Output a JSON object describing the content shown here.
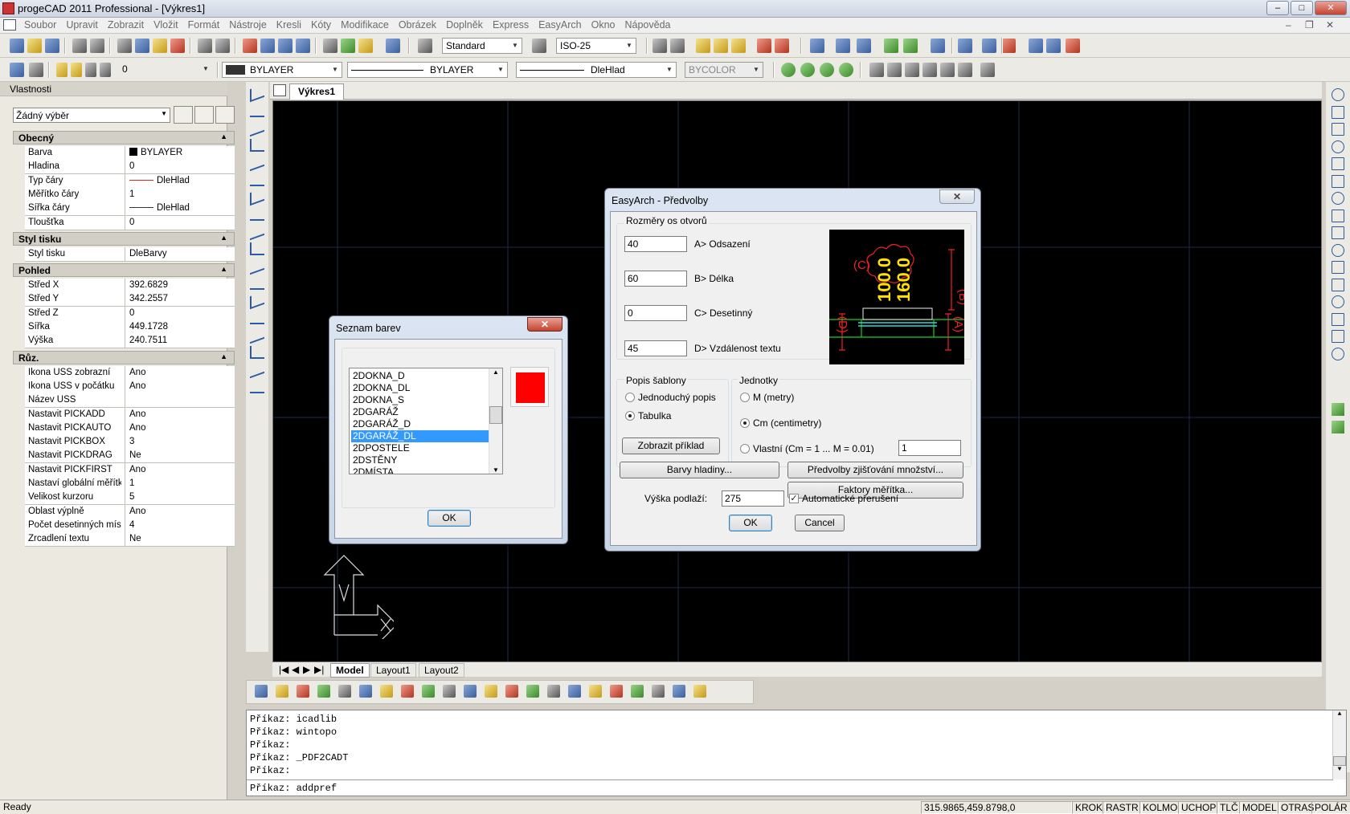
{
  "window": {
    "title": "progeCAD 2011 Professional - [Výkres1]",
    "min": "‒",
    "max": "□",
    "close": "✕"
  },
  "menu": [
    "Soubor",
    "Upravit",
    "Zobrazit",
    "Vložit",
    "Formát",
    "Nástroje",
    "Kresli",
    "Kóty",
    "Modifikace",
    "Obrázek",
    "Doplněk",
    "Express",
    "EasyArch",
    "Okno",
    "Nápověda"
  ],
  "toolbar1": {
    "text_style": "Standard",
    "dim_style": "ISO-25"
  },
  "toolbar2": {
    "layer": "0",
    "color": "BYLAYER",
    "linetype": "BYLAYER",
    "lineweight": "DleHlad",
    "plotstyle": "BYCOLOR"
  },
  "properties": {
    "title": "Vlastnosti",
    "selection": "Žádný výběr",
    "sections": [
      {
        "name": "Obecný",
        "toggle": "▲",
        "rows": [
          {
            "k": "Barva",
            "v": "BYLAYER",
            "kind": "swatch"
          },
          {
            "k": "Hladina",
            "v": "0"
          },
          {
            "k": "Typ čáry",
            "v": "DleHlad",
            "kind": "redline"
          },
          {
            "k": "Měřítko čáry",
            "v": "1"
          },
          {
            "k": "Šířka čáry",
            "v": "DleHlad",
            "kind": "line"
          },
          {
            "k": "Tloušťka",
            "v": "0"
          }
        ]
      },
      {
        "name": "Styl tisku",
        "toggle": "▲",
        "rows": [
          {
            "k": "Styl tisku",
            "v": "DleBarvy"
          }
        ]
      },
      {
        "name": "Pohled",
        "toggle": "▲",
        "rows": [
          {
            "k": "Střed X",
            "v": "392.6829"
          },
          {
            "k": "Střed Y",
            "v": "342.2557"
          },
          {
            "k": "Střed Z",
            "v": "0"
          },
          {
            "k": "Šířka",
            "v": "449.1728"
          },
          {
            "k": "Výška",
            "v": "240.7511"
          }
        ]
      },
      {
        "name": "Růz.",
        "toggle": "▲",
        "rows": [
          {
            "k": "Ikona USS zobrazní",
            "v": "Ano"
          },
          {
            "k": "Ikona USS v počátku",
            "v": "Ano"
          },
          {
            "k": "Název USS",
            "v": ""
          },
          {
            "k": "Nastavit PICKADD",
            "v": "Ano"
          },
          {
            "k": "Nastavit PICKAUTO",
            "v": "Ano"
          },
          {
            "k": "Nastavit PICKBOX",
            "v": "3"
          },
          {
            "k": "Nastavit PICKDRAG",
            "v": "Ne"
          },
          {
            "k": "Nastavit PICKFIRST",
            "v": "Ano"
          },
          {
            "k": "Nastaví globální měřítk...",
            "v": "1"
          },
          {
            "k": "Velikost kurzoru",
            "v": "5"
          },
          {
            "k": "Oblast výplně",
            "v": "Ano"
          },
          {
            "k": "Počet desetinných míst",
            "v": "4"
          },
          {
            "k": "Zrcadlení textu",
            "v": "Ne"
          }
        ]
      }
    ]
  },
  "drawing_tab": "Výkres1",
  "layout_tabs": [
    "Model",
    "Layout1",
    "Layout2"
  ],
  "command": {
    "history": [
      "Příkaz: icadlib",
      "Příkaz: wintopo",
      "Příkaz:",
      "Příkaz: _PDF2CADT",
      "Příkaz:"
    ],
    "current": "Příkaz: addpref"
  },
  "status": {
    "ready": "Ready",
    "coords": "315.9865,459.8798,0",
    "modes": [
      "KROK",
      "RASTR",
      "KOLMO",
      "UCHOP",
      "TLČ",
      "MODEL",
      "OTRAS",
      "POLÁR"
    ]
  },
  "color_dialog": {
    "title": "Seznam barev",
    "close": "✕",
    "items": [
      "2DOKNA_D",
      "2DOKNA_DL",
      "2DOKNA_S",
      "2DGARÁŽ",
      "2DGARÁŽ_D",
      "2DGARÁŽ_DL",
      "2DPOSTELE",
      "2DSTĚNY",
      "2DMÍSTA"
    ],
    "selected_index": 5,
    "swatch_color": "#ff0000",
    "ok": "OK"
  },
  "easyarch_dialog": {
    "title": "EasyArch - Předvolby",
    "close": "✕",
    "group_openings": "Rozměry os otvorů",
    "fields": [
      {
        "value": "40",
        "label": "A> Odsazení"
      },
      {
        "value": "60",
        "label": "B> Délka"
      },
      {
        "value": "0",
        "label": "C> Desetinný"
      },
      {
        "value": "45",
        "label": "D> Vzdálenost textu"
      }
    ],
    "preview": {
      "val1": "100.0",
      "val2": "160.0",
      "c": "(C)",
      "b": "(B)",
      "d": "(D)",
      "a": "(A)"
    },
    "group_template": "Popis šablony",
    "opt_simple": "Jednoduchý popis",
    "opt_table": "Tabulka",
    "show_example": "Zobrazit příklad",
    "group_units": "Jednotky",
    "unit_m": "M (metry)",
    "unit_cm": "Cm (centimetry)",
    "unit_custom": "Vlastní (Cm = 1 ... M = 0.01)",
    "custom_value": "1",
    "layer_colors": "Barvy hladiny...",
    "qty_settings": "Předvolby zjišťování množství...",
    "scale_factors": "Faktory měřítka...",
    "floor_height_label": "Výška podlaží:",
    "floor_height": "275",
    "auto_break": "Automatické přerušení",
    "ok": "OK",
    "cancel": "Cancel"
  }
}
